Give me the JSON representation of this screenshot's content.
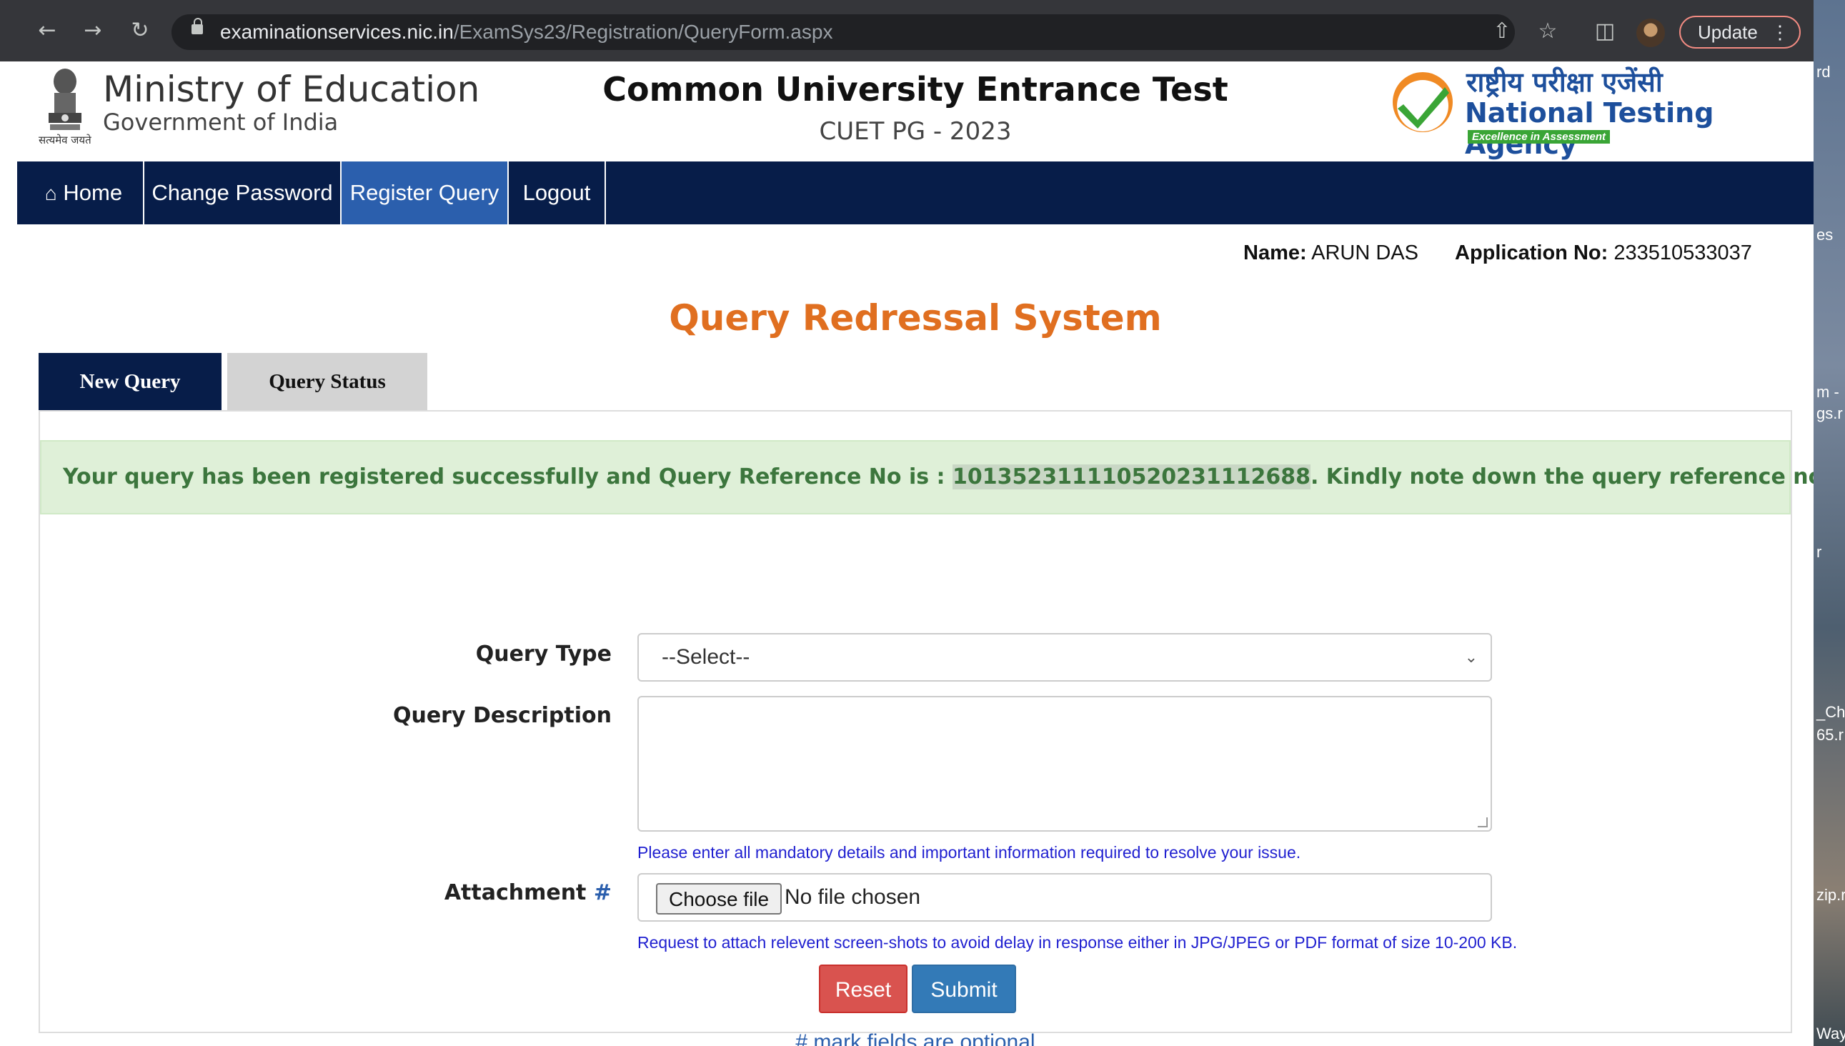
{
  "browser": {
    "url_host": "examinationservices.nic.in",
    "url_path": "/ExamSys23/Registration/QueryForm.aspx",
    "update_label": "Update"
  },
  "header": {
    "ministry": "Ministry of Education",
    "government": "Government of India",
    "emblem_motto": "सत्यमेव जयते",
    "exam_title": "Common University Entrance Test",
    "exam_subtitle": "CUET PG - 2023",
    "agency_hindi": "राष्ट्रीय परीक्षा एजेंसी",
    "agency_english": "National Testing Agency",
    "agency_tagline": "Excellence in Assessment"
  },
  "nav": {
    "home": "Home",
    "change_password": "Change Password",
    "register_query": "Register Query",
    "logout": "Logout"
  },
  "user": {
    "name_label": "Name:",
    "name_value": "ARUN DAS",
    "app_label": "Application No:",
    "app_value": "233510533037"
  },
  "page_title": "Query Redressal System",
  "tabs": {
    "new_query": "New Query",
    "query_status": "Query Status"
  },
  "alert": {
    "prefix": "Your query has been registered successfully and Query Reference No is : ",
    "ref_no": "101352311110520231112688",
    "suffix": ". Kindly note down the query reference no for future references."
  },
  "form": {
    "query_type_label": "Query Type",
    "query_type_value": "--Select--",
    "query_desc_label": "Query Description",
    "query_desc_help": "Please enter all mandatory details and important information required to resolve your issue.",
    "attachment_label": "Attachment",
    "attachment_optional_mark": "#",
    "choose_file_label": "Choose file",
    "no_file_text": "No file chosen",
    "attachment_help": "Request to attach relevent screen-shots to avoid delay in response either in JPG/JPEG or PDF format of size 10-200 KB.",
    "reset_label": "Reset",
    "submit_label": "Submit",
    "optional_note": "# mark fields are optional"
  },
  "desktop": {
    "labels": [
      "rd",
      "es",
      "m -",
      "gs.r",
      "r",
      "_Ch",
      "65.r",
      "zip.r",
      "Way"
    ]
  },
  "colors": {
    "nav_bg": "#071d49",
    "nav_active": "#2b5fad",
    "title_orange": "#e06f20",
    "success_bg": "#dff0d8",
    "success_text": "#3c763d"
  }
}
